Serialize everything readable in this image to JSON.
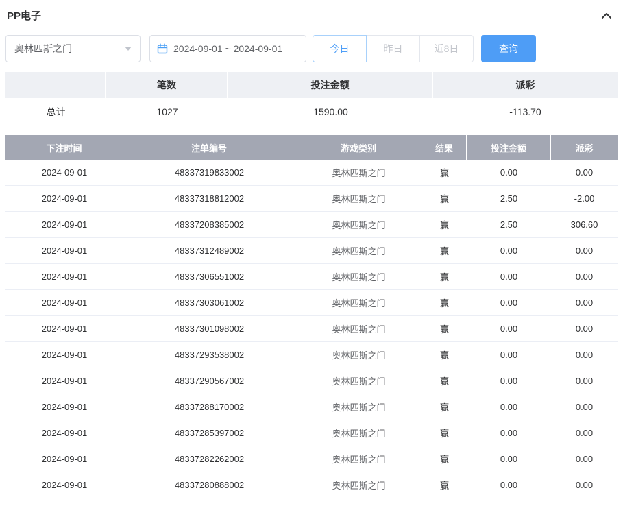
{
  "colors": {
    "accent_blue": "#4e9df6",
    "negative_red": "#f55a5a",
    "table_header_bg": "#a3a7b3",
    "summary_header_bg": "#eef0f4"
  },
  "panel": {
    "title": "PP电子"
  },
  "filters": {
    "game_select": {
      "value": "奥林匹斯之门"
    },
    "date_range": {
      "value": "2024-09-01 ~ 2024-09-01"
    },
    "quick_buttons": [
      {
        "label": "今日",
        "active": true
      },
      {
        "label": "昨日",
        "active": false
      },
      {
        "label": "近8日",
        "active": false
      }
    ],
    "query_button_label": "查询"
  },
  "summary": {
    "headers": [
      "",
      "笔数",
      "投注金额",
      "派彩"
    ],
    "total_label": "总计",
    "count": "1027",
    "bet_amount": "1590.00",
    "payout": "-113.70"
  },
  "table": {
    "headers": [
      "下注时间",
      "注单编号",
      "游戏类别",
      "结果",
      "投注金额",
      "派彩"
    ],
    "rows": [
      {
        "time": "2024-09-01",
        "order_no": "48337319833002",
        "game": "奥林匹斯之门",
        "result": "赢",
        "bet": "0.00",
        "payout": "0.00"
      },
      {
        "time": "2024-09-01",
        "order_no": "48337318812002",
        "game": "奥林匹斯之门",
        "result": "赢",
        "bet": "2.50",
        "payout": "-2.00"
      },
      {
        "time": "2024-09-01",
        "order_no": "48337208385002",
        "game": "奥林匹斯之门",
        "result": "赢",
        "bet": "2.50",
        "payout": "306.60"
      },
      {
        "time": "2024-09-01",
        "order_no": "48337312489002",
        "game": "奥林匹斯之门",
        "result": "赢",
        "bet": "0.00",
        "payout": "0.00"
      },
      {
        "time": "2024-09-01",
        "order_no": "48337306551002",
        "game": "奥林匹斯之门",
        "result": "赢",
        "bet": "0.00",
        "payout": "0.00"
      },
      {
        "time": "2024-09-01",
        "order_no": "48337303061002",
        "game": "奥林匹斯之门",
        "result": "赢",
        "bet": "0.00",
        "payout": "0.00"
      },
      {
        "time": "2024-09-01",
        "order_no": "48337301098002",
        "game": "奥林匹斯之门",
        "result": "赢",
        "bet": "0.00",
        "payout": "0.00"
      },
      {
        "time": "2024-09-01",
        "order_no": "48337293538002",
        "game": "奥林匹斯之门",
        "result": "赢",
        "bet": "0.00",
        "payout": "0.00"
      },
      {
        "time": "2024-09-01",
        "order_no": "48337290567002",
        "game": "奥林匹斯之门",
        "result": "赢",
        "bet": "0.00",
        "payout": "0.00"
      },
      {
        "time": "2024-09-01",
        "order_no": "48337288170002",
        "game": "奥林匹斯之门",
        "result": "赢",
        "bet": "0.00",
        "payout": "0.00"
      },
      {
        "time": "2024-09-01",
        "order_no": "48337285397002",
        "game": "奥林匹斯之门",
        "result": "赢",
        "bet": "0.00",
        "payout": "0.00"
      },
      {
        "time": "2024-09-01",
        "order_no": "48337282262002",
        "game": "奥林匹斯之门",
        "result": "赢",
        "bet": "0.00",
        "payout": "0.00"
      },
      {
        "time": "2024-09-01",
        "order_no": "48337280888002",
        "game": "奥林匹斯之门",
        "result": "赢",
        "bet": "0.00",
        "payout": "0.00"
      }
    ]
  }
}
